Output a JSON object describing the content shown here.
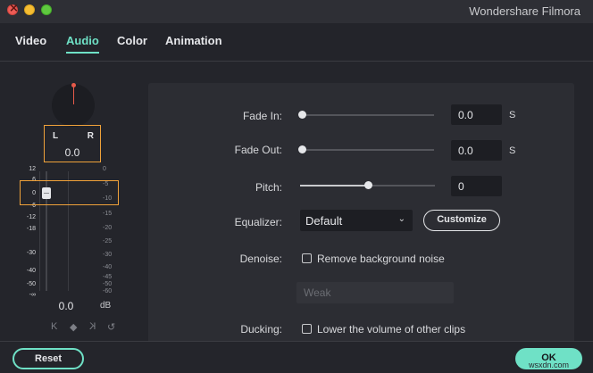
{
  "window": {
    "title": "Wondershare Filmora",
    "controls": [
      "close",
      "minimize",
      "maximize"
    ]
  },
  "tabs": [
    {
      "label": "Video",
      "active": false
    },
    {
      "label": "Audio",
      "active": true
    },
    {
      "label": "Color",
      "active": false
    },
    {
      "label": "Animation",
      "active": false
    }
  ],
  "meter": {
    "left_label": "L",
    "right_label": "R",
    "pan_value": "0.0",
    "left_scale": [
      "12",
      "6",
      "0",
      "-6",
      "-12",
      "-18",
      "-30",
      "-40",
      "-50",
      "-∞"
    ],
    "right_scale": [
      "0",
      "-5",
      "-10",
      "-15",
      "-20",
      "-25",
      "-30",
      "-40",
      "-45",
      "-50",
      "-60"
    ],
    "volume_value": "0.0",
    "volume_unit": "dB",
    "controls": [
      "K",
      "◆",
      "K",
      "↺"
    ]
  },
  "audio": {
    "fade_in": {
      "label": "Fade In:",
      "value": "0.0",
      "unit": "S",
      "level": 0.0
    },
    "fade_out": {
      "label": "Fade Out:",
      "value": "0.0",
      "unit": "S",
      "level": 0.0
    },
    "pitch": {
      "label": "Pitch:",
      "value": "0",
      "level": 0.5
    },
    "equalizer": {
      "label": "Equalizer:",
      "selected": "Default",
      "customize_label": "Customize"
    },
    "denoise": {
      "label": "Denoise:",
      "checkbox_label": "Remove background noise",
      "checked": false,
      "level_value": "Weak"
    },
    "ducking": {
      "label": "Ducking:",
      "checkbox_label": "Lower the volume of other clips",
      "checked": false
    }
  },
  "footer": {
    "reset_label": "Reset",
    "ok_label": "OK",
    "watermark": "wsxdn.com"
  },
  "colors": {
    "accent": "#6fe1c6",
    "highlight_box": "#f0a23a",
    "background": "#24252b",
    "panel": "#2c2d33"
  }
}
